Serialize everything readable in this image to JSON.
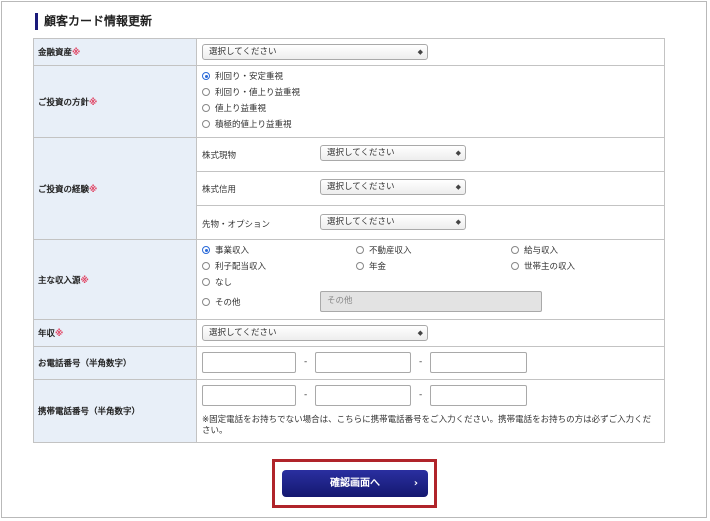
{
  "title": "顧客カード情報更新",
  "required_mark": "※",
  "fields": {
    "assets": {
      "label": "金融資産",
      "select": "選択してください"
    },
    "policy": {
      "label": "ご投資の方針",
      "options": [
        "利回り・安定重視",
        "利回り・値上り益重視",
        "値上り益重視",
        "積極的値上り益重視"
      ],
      "selected_index": 0
    },
    "experience": {
      "label": "ご投資の経験",
      "rows": [
        {
          "label": "株式現物",
          "select": "選択してください"
        },
        {
          "label": "株式信用",
          "select": "選択してください"
        },
        {
          "label": "先物・オプション",
          "select": "選択してください"
        }
      ]
    },
    "income_source": {
      "label": "主な収入源",
      "options": [
        "事業収入",
        "不動産収入",
        "給与収入",
        "利子配当収入",
        "年金",
        "世帯主の収入",
        "なし",
        "その他"
      ],
      "selected_index": 0,
      "other_placeholder": "その他"
    },
    "annual_income": {
      "label": "年収",
      "select": "選択してください"
    },
    "phone": {
      "label": "お電話番号（半角数字）",
      "separator": "-"
    },
    "mobile": {
      "label": "携帯電話番号（半角数字）",
      "separator": "-",
      "note": "※固定電話をお持ちでない場合は、こちらに携帯電話番号をご入力ください。携帯電話をお持ちの方は必ずご入力ください。"
    }
  },
  "submit_label": "確認画面へ",
  "icons": {
    "select_arrow": "up-down-arrows-icon",
    "chevron": "chevron-right-icon"
  }
}
